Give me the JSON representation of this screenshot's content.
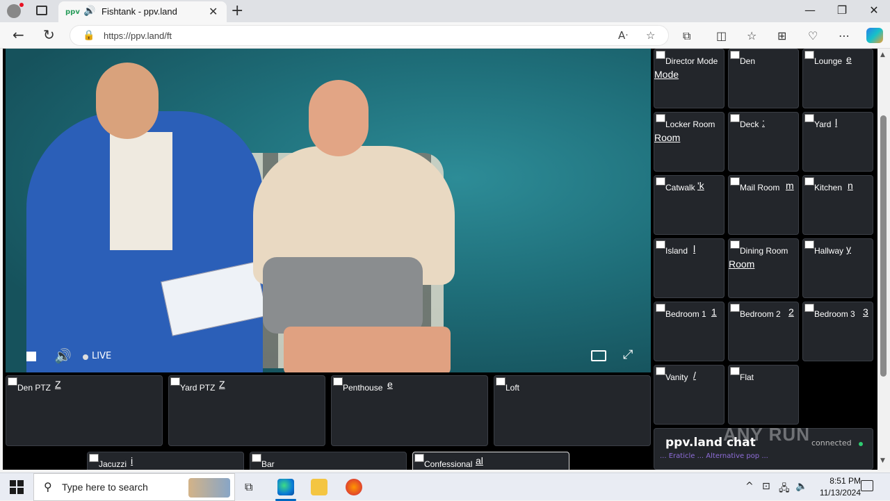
{
  "browser": {
    "tab_title": "Fishtank - ppv.land",
    "url": "https://ppv.land/ft"
  },
  "video": {
    "live_label": "LIVE"
  },
  "cameras": [
    {
      "label": "Director Mode",
      "ghost": "Mode"
    },
    {
      "label": "Den",
      "ghost": ""
    },
    {
      "label": "Lounge",
      "ghost": "e"
    },
    {
      "label": "Locker Room",
      "ghost": "Room"
    },
    {
      "label": "Deck",
      "ghost": ":"
    },
    {
      "label": "Yard",
      "ghost": "l"
    },
    {
      "label": "Catwalk",
      "ghost": "'k"
    },
    {
      "label": "Mail Room",
      "ghost": "m"
    },
    {
      "label": "Kitchen",
      "ghost": "n"
    },
    {
      "label": "Island",
      "ghost": "l"
    },
    {
      "label": "Dining Room",
      "ghost": "Room"
    },
    {
      "label": "Hallway",
      "ghost": "y"
    },
    {
      "label": "Bedroom 1",
      "ghost": "1"
    },
    {
      "label": "Bedroom 2",
      "ghost": "2"
    },
    {
      "label": "Bedroom 3",
      "ghost": "3"
    },
    {
      "label": "Vanity",
      "ghost": "/"
    },
    {
      "label": "Flat",
      "ghost": ""
    }
  ],
  "bottom_cameras": [
    {
      "label": "Den PTZ",
      "ghost": "Z"
    },
    {
      "label": "Yard PTZ",
      "ghost": "Z"
    },
    {
      "label": "Penthouse",
      "ghost": "e"
    },
    {
      "label": "Loft",
      "ghost": ""
    },
    {
      "label": "Jacuzzi",
      "ghost": "i"
    },
    {
      "label": "Bar",
      "ghost": ""
    },
    {
      "label": "Confessional",
      "ghost": "al"
    }
  ],
  "chat": {
    "title": "ppv.land chat",
    "status": "connected",
    "message": "... Eraticle ... Alternative pop ..."
  },
  "watermark": "ANY RUN",
  "taskbar": {
    "search_placeholder": "Type here to search",
    "time": "8:51 PM",
    "date": "11/13/2024"
  },
  "colors": {
    "accent": "#0067c0",
    "tile_bg": "#23262b",
    "status_dot": "#2ecc71"
  }
}
